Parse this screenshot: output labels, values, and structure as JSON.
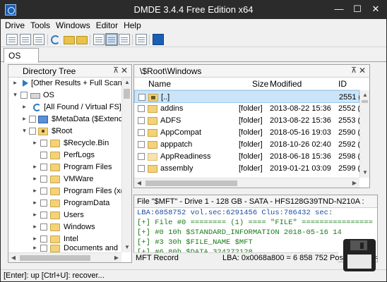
{
  "window": {
    "title": "DMDE 3.4.4 Free Edition x64",
    "controls": {
      "minimize": "—",
      "maximize": "☐",
      "close": "✕"
    }
  },
  "menu": [
    "Drive",
    "Tools",
    "Windows",
    "Editor",
    "Help"
  ],
  "toolbar_icons": [
    "doc-icon",
    "doc-icon",
    "doc-icon",
    "refresh-icon",
    "folder-icon",
    "folder-icon",
    "folder-icon",
    "panel-icon",
    "list-view-icon",
    "doc-icon",
    "window-icon",
    "dmde-icon"
  ],
  "tab": {
    "label": "OS"
  },
  "directory_tree": {
    "title": "Directory Tree",
    "pin": "⊼",
    "close": "✕",
    "items": [
      {
        "label": "[Other Results + Full Scan]",
        "icon": "play-icon",
        "expander": "▸"
      },
      {
        "label": "OS",
        "icon": "drive-icon",
        "expander": "▾"
      },
      {
        "label": "[All Found / Virtual FS]",
        "icon": "refresh-icon",
        "expander": "▸"
      },
      {
        "label": "$MetaData ($Extenc",
        "icon": "blue-folder-icon",
        "expander": "▸"
      },
      {
        "label": "$Root",
        "icon": "locked-folder-icon",
        "expander": "▾"
      },
      {
        "label": "$Recycle.Bin",
        "icon": "folder-icon",
        "expander": "▸"
      },
      {
        "label": "PerfLogs",
        "icon": "folder-icon",
        "expander": ""
      },
      {
        "label": "Program Files",
        "icon": "folder-icon",
        "expander": "▸"
      },
      {
        "label": "VMWare",
        "icon": "folder-icon",
        "expander": "▸"
      },
      {
        "label": "Program Files (x(",
        "icon": "folder-icon",
        "expander": "▸"
      },
      {
        "label": "ProgramData",
        "icon": "folder-icon",
        "expander": "▸"
      },
      {
        "label": "Users",
        "icon": "folder-icon",
        "expander": "▸"
      },
      {
        "label": "Windows",
        "icon": "folder-icon",
        "expander": "▸"
      },
      {
        "label": "Intel",
        "icon": "folder-icon",
        "expander": "▸"
      },
      {
        "label": "Documents and",
        "icon": "folder-icon",
        "expander": "▸"
      }
    ]
  },
  "file_panel": {
    "path": "\\$Root\\Windows",
    "pin": "⊼",
    "close": "✕",
    "columns": {
      "name": "Name",
      "size": "Size",
      "modified": "Modified",
      "id": "ID"
    },
    "rows": [
      {
        "name": "[..]",
        "size": "",
        "modified": "",
        "id": "2551 (1)",
        "selected": true
      },
      {
        "name": "addins",
        "size": "[folder]",
        "modified": "2013-08-22 15:36",
        "id": "2552 (1)"
      },
      {
        "name": "ADFS",
        "size": "[folder]",
        "modified": "2013-08-22 15:36",
        "id": "2553 (1)"
      },
      {
        "name": "AppCompat",
        "size": "[folder]",
        "modified": "2018-05-16 19:03",
        "id": "2590 (1)"
      },
      {
        "name": "apppatch",
        "size": "[folder]",
        "modified": "2018-10-26 02:40",
        "id": "2592 (1)"
      },
      {
        "name": "AppReadiness",
        "size": "[folder]",
        "modified": "2018-06-18 15:36",
        "id": "2598 (1)"
      },
      {
        "name": "assembly",
        "size": "[folder]",
        "modified": "2019-01-21 03:09",
        "id": "2599 (1)"
      }
    ]
  },
  "hex_panel": {
    "header": "File \"$MFT\" - Drive 1 - 128 GB - SATA - HFS128G39TND-N210A : ",
    "lines": [
      "  LBA:6858752              vol.sec:6291456 Clus:786432 sec:",
      "[+] File #0 ======== (1) ==== \"FILE\" ================",
      "[+] #0         10h $STANDARD_INFORMATION 2018-05-16 14",
      "[+] #3         30h $FILE_NAME $MFT",
      "[+] #6         80h $DATA      324272128"
    ],
    "bottom_left": "MFT Record",
    "bottom_right": "LBA: 0x0068a800 = 6 858 752  Pos 0x0000 ="
  },
  "status_bar": "[Enter]: up  [Ctrl+U]: recover..."
}
